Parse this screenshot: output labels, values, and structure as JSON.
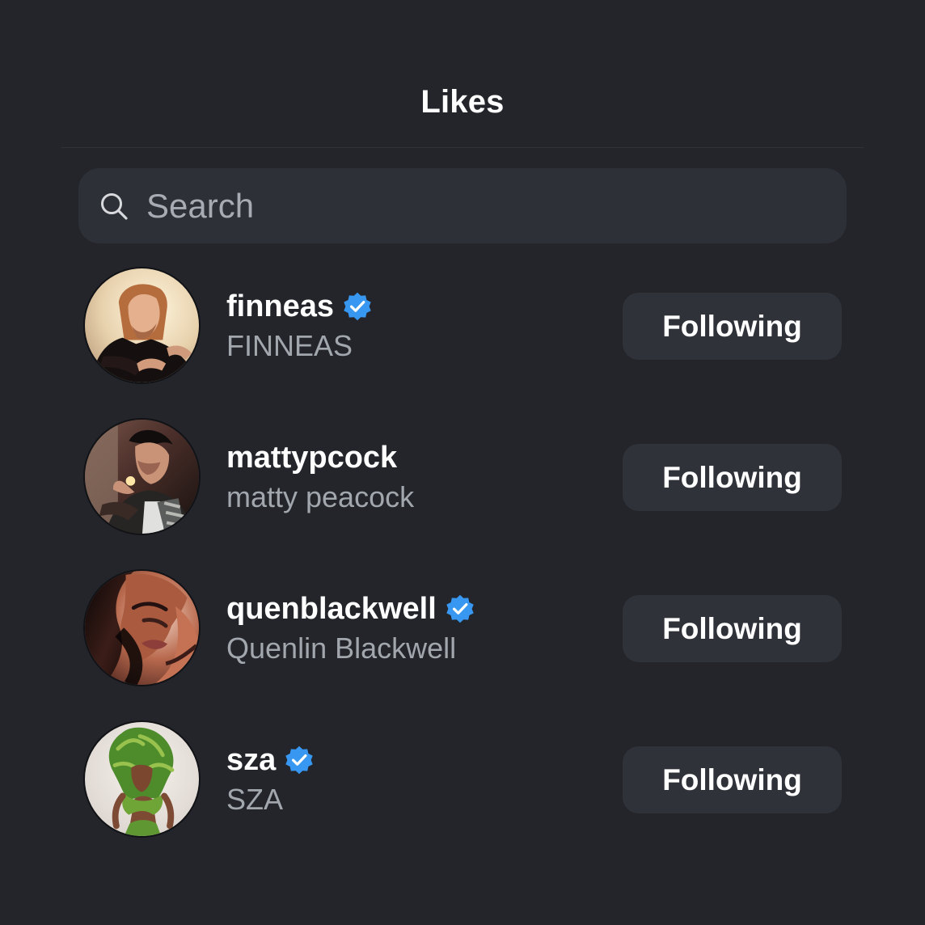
{
  "header": {
    "title": "Likes"
  },
  "search": {
    "placeholder": "Search",
    "icon": "search-icon"
  },
  "colors": {
    "background": "#23252b",
    "search_background": "#2e3038",
    "button_background": "#30323a",
    "primary_text": "#ffffff",
    "secondary_text": "#a2a6ad",
    "verified_blue": "#3897f0"
  },
  "users": [
    {
      "username": "finneas",
      "display_name": "FINNEAS",
      "verified": true,
      "button_label": "Following",
      "avatar_icon": "finneas-avatar"
    },
    {
      "username": "mattypcock",
      "display_name": "matty peacock",
      "verified": false,
      "button_label": "Following",
      "avatar_icon": "mattypcock-avatar"
    },
    {
      "username": "quenblackwell",
      "display_name": "Quenlin Blackwell",
      "verified": true,
      "button_label": "Following",
      "avatar_icon": "quenblackwell-avatar"
    },
    {
      "username": "sza",
      "display_name": "SZA",
      "verified": true,
      "button_label": "Following",
      "avatar_icon": "sza-avatar"
    }
  ]
}
